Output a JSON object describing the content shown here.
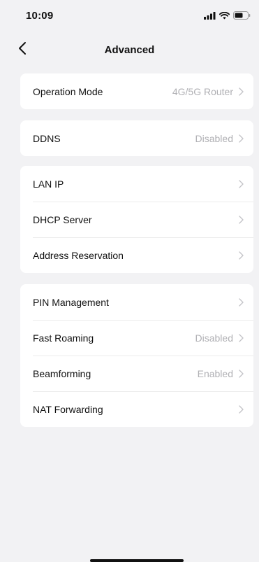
{
  "status_bar": {
    "time": "10:09"
  },
  "nav": {
    "title": "Advanced"
  },
  "groups": [
    [
      {
        "label": "Operation Mode",
        "value": "4G/5G Router"
      }
    ],
    [
      {
        "label": "DDNS",
        "value": "Disabled"
      }
    ],
    [
      {
        "label": "LAN IP",
        "value": ""
      },
      {
        "label": "DHCP Server",
        "value": ""
      },
      {
        "label": "Address Reservation",
        "value": ""
      }
    ],
    [
      {
        "label": "PIN Management",
        "value": ""
      },
      {
        "label": "Fast Roaming",
        "value": "Disabled"
      },
      {
        "label": "Beamforming",
        "value": "Enabled"
      },
      {
        "label": "NAT Forwarding",
        "value": ""
      }
    ]
  ],
  "colors": {
    "background": "#f2f2f4",
    "card": "#ffffff",
    "secondary_text": "#b0b0b4",
    "chevron": "#c4c4c8"
  }
}
